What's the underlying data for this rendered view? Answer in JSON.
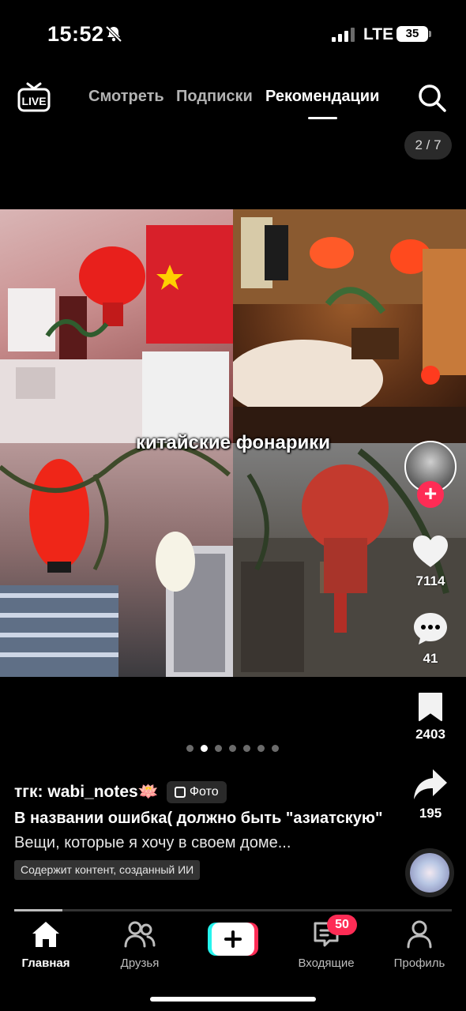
{
  "status_bar": {
    "time": "15:52",
    "network": "LTE",
    "battery": "35"
  },
  "top_nav": {
    "tabs": [
      {
        "label": "Смотреть",
        "active": false
      },
      {
        "label": "Подписки",
        "active": false
      },
      {
        "label": "Рекомендации",
        "active": true
      }
    ]
  },
  "page_counter": "2 / 7",
  "photo": {
    "overlay_text": "китайские фонарики"
  },
  "carousel": {
    "total": 7,
    "active_index": 1
  },
  "engagement": {
    "likes": "7114",
    "comments": "41",
    "saves": "2403",
    "shares": "195"
  },
  "post": {
    "author": "тгк: wabi_notes🪷",
    "badge": "Фото",
    "title": "В названии ошибка( должно быть \"азиатскую\"",
    "description": "Вещи, которые я хочу в своем доме...",
    "ai_label": "Содержит контент, созданный ИИ",
    "progress": 0.11
  },
  "bottom_nav": {
    "home": "Главная",
    "friends": "Друзья",
    "inbox": "Входящие",
    "inbox_badge": "50",
    "profile": "Профиль"
  },
  "colors": {
    "accent": "#fe2c55",
    "cyan": "#25f4ee",
    "background": "#000000"
  }
}
